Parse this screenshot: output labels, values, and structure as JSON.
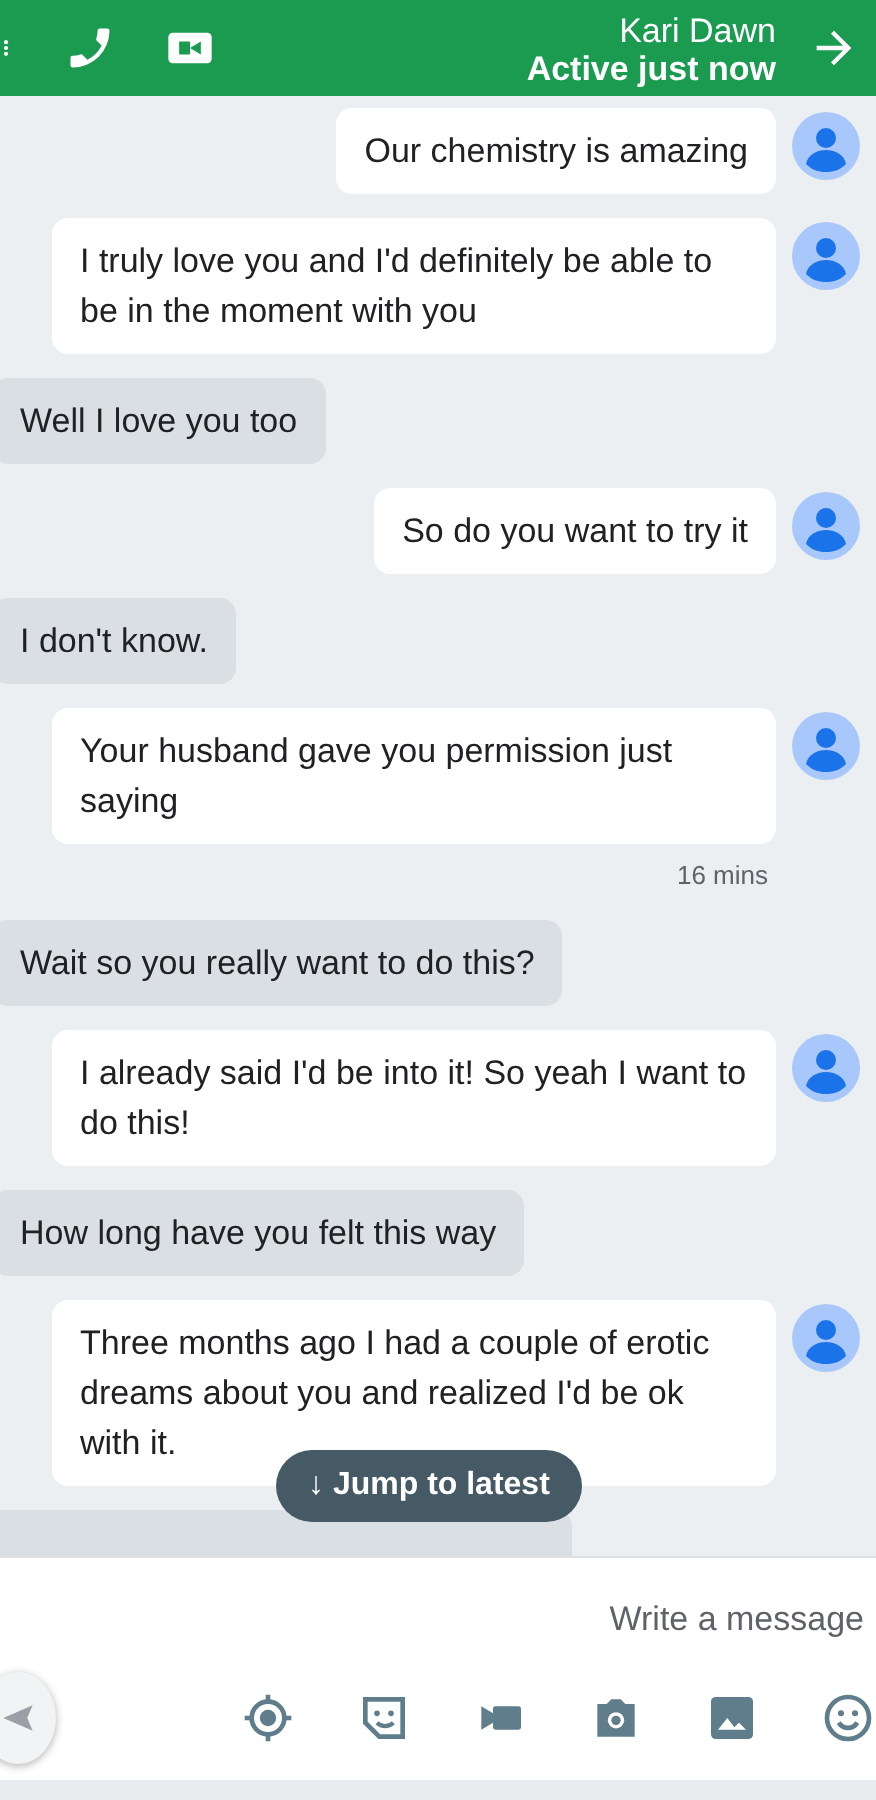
{
  "header": {
    "title": "Kari Dawn",
    "status": "Active just now"
  },
  "messages": [
    {
      "kind": "incoming",
      "text": "Our chemistry is amazing"
    },
    {
      "kind": "incoming",
      "text": "I truly love you and I'd definitely be able to be in the moment with you"
    },
    {
      "kind": "outgoing",
      "text": "Well I love you too"
    },
    {
      "kind": "incoming",
      "text": "So do you want to try it"
    },
    {
      "kind": "outgoing",
      "text": "I don't know."
    },
    {
      "kind": "incoming",
      "text": "Your husband gave you permission just saying",
      "time": "16 mins"
    },
    {
      "kind": "outgoing",
      "text": "Wait so you really want to do this?"
    },
    {
      "kind": "incoming",
      "text": "I already said I'd be into it!  So yeah I want to do this!"
    },
    {
      "kind": "outgoing",
      "text": "How long have you felt this way"
    },
    {
      "kind": "incoming",
      "text": "Three months ago I had a couple of erotic dreams about you and realized I'd be ok with it."
    }
  ],
  "jump_button": "↓ Jump to latest",
  "composer": {
    "placeholder": "Write a message"
  }
}
